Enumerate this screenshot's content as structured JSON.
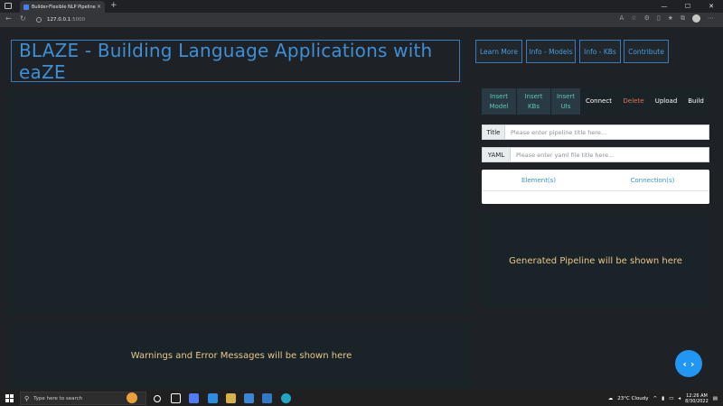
{
  "browser": {
    "tab_title": "Builder-Flexible NLP Pipeline",
    "tab_close": "×",
    "new_tab": "+",
    "url_host": "127.0.0.1",
    "url_port": ":5000"
  },
  "header": {
    "title": "BLAZE - Building Language Applications with eaZE"
  },
  "top_nav": {
    "learn_more": "Learn More",
    "info_models": "Info - Models",
    "info_kbs": "Info - KBs",
    "contribute": "Contribute"
  },
  "toolbar": {
    "insert_model_1": "Insert",
    "insert_model_2": "Model",
    "insert_kbs_1": "Insert",
    "insert_kbs_2": "KBs",
    "insert_uis_1": "Insert",
    "insert_uis_2": "UIs",
    "connect": "Connect",
    "delete": "Delete",
    "upload": "Upload",
    "build": "Build"
  },
  "form": {
    "title_label": "Title",
    "title_placeholder": "Please enter pipeline title here...",
    "yaml_label": "YAML",
    "yaml_placeholder": "Please enter yaml file title here..."
  },
  "table": {
    "col_elements": "Element(s)",
    "col_connections": "Connection(s)"
  },
  "messages": {
    "console": "Warnings and Error Messages will be shown here",
    "pipeline": "Generated Pipeline will be shown here"
  },
  "fab": {
    "label": "‹ ›"
  },
  "taskbar": {
    "search_placeholder": "Type here to search",
    "weather": "23°C  Cloudy",
    "time": "12:26 AM",
    "date": "8/30/2022"
  },
  "colors": {
    "accent": "#3d8fd6",
    "message": "#e9c68f",
    "teal": "#5ec8b5",
    "danger": "#e8735a",
    "fab": "#2196f3"
  }
}
